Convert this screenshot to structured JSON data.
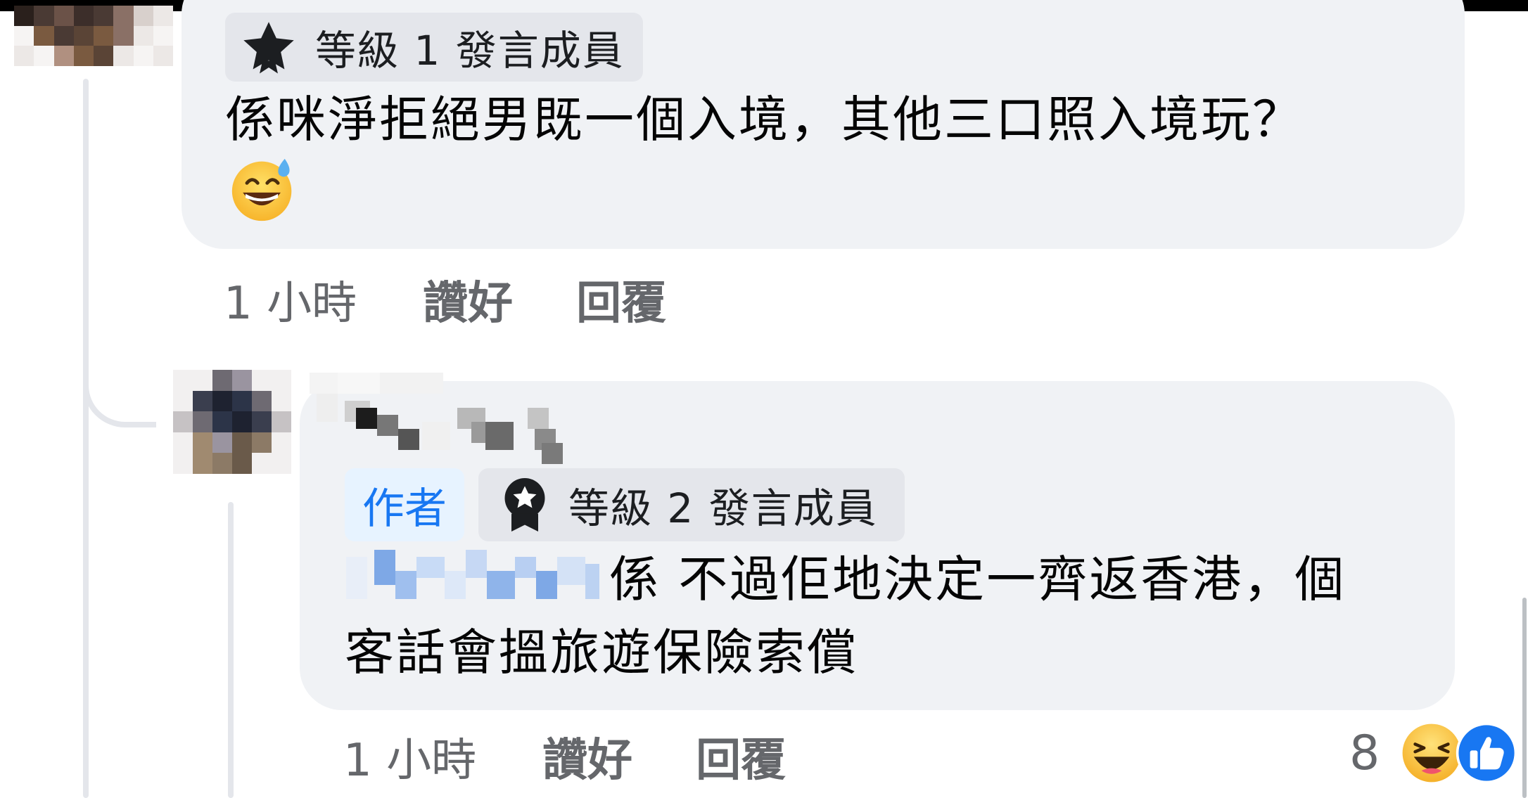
{
  "comment_1": {
    "badge_label": "等級 1 發言成員",
    "text": "係咪淨拒絕男既一個入境，其他三口照入境玩？",
    "emoji": "grinning-sweat",
    "time": "1 小時",
    "like_label": "讚好",
    "reply_label": "回覆"
  },
  "comment_2": {
    "author_tag": "作者",
    "badge_label": "等級 2 發言成員",
    "text_line1": "係 不過佢地決定一齊返香港，個",
    "text_line2": "客話會搵旅遊保險索償",
    "time": "1 小時",
    "like_label": "讚好",
    "reply_label": "回覆",
    "reaction_count": "8",
    "reactions": [
      "haha",
      "like"
    ]
  },
  "colors": {
    "bubble": "#f0f2f5",
    "badge": "#e4e6eb",
    "author_blue": "#1877f2",
    "meta_gray": "#65676b",
    "text": "#050505"
  },
  "icons": {
    "badge_1": "star-icon",
    "badge_2": "medal-icon"
  }
}
